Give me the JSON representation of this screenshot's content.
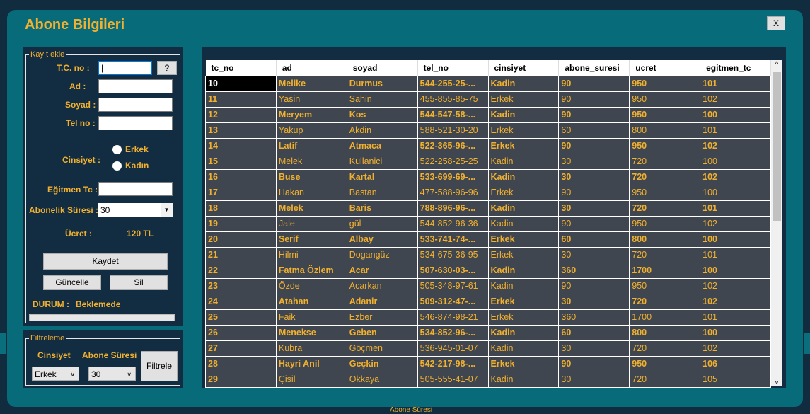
{
  "window": {
    "title": "Abone Bilgileri",
    "close_label": "X"
  },
  "background": {
    "legend": "Abone Süresi"
  },
  "kayit": {
    "legend": "Kayıt ekle",
    "tc_label": "T.C. no :",
    "help_label": "?",
    "ad_label": "Ad :",
    "soyad_label": "Soyad :",
    "tel_label": "Tel no :",
    "cinsiyet_label": "Cinsiyet :",
    "erkek": "Erkek",
    "kadin": "Kadın",
    "egitmen_label": "Eğitmen Tc :",
    "sure_label": "Abonelik Süresi :",
    "sure_value": "30",
    "ucret_label": "Ücret :",
    "ucret_value": "120 TL",
    "kaydet": "Kaydet",
    "guncelle": "Güncelle",
    "sil": "Sil",
    "durum_label": "DURUM :",
    "durum_value": "Beklemede",
    "progress": 0
  },
  "filtre": {
    "legend": "Filtreleme",
    "cinsiyet_label": "Cinsiyet",
    "sure_label": "Abone Süresi",
    "cinsiyet_value": "Erkek",
    "sure_value": "30",
    "button": "Filtrele"
  },
  "grid": {
    "columns": [
      "tc_no",
      "ad",
      "soyad",
      "tel_no",
      "cinsiyet",
      "abone_suresi",
      "ucret",
      "egitmen_tc"
    ],
    "rows": [
      [
        "10",
        "Melike",
        "Durmus",
        "544-255-25-...",
        "Kadin",
        "90",
        "950",
        "101"
      ],
      [
        "11",
        "Yasin",
        "Sahin",
        "455-855-85-75",
        "Erkek",
        "90",
        "950",
        "102"
      ],
      [
        "12",
        "Meryem",
        "Kos",
        "544-547-58-...",
        "Kadin",
        "90",
        "950",
        "100"
      ],
      [
        "13",
        "Yakup",
        "Akdin",
        "588-521-30-20",
        "Erkek",
        "60",
        "800",
        "101"
      ],
      [
        "14",
        "Latif",
        "Atmaca",
        "522-365-96-...",
        "Erkek",
        "90",
        "950",
        "102"
      ],
      [
        "15",
        "Melek",
        "Kullanici",
        "522-258-25-25",
        "Kadin",
        "30",
        "720",
        "100"
      ],
      [
        "16",
        "Buse",
        "Kartal",
        "533-699-69-...",
        "Kadin",
        "30",
        "720",
        "102"
      ],
      [
        "17",
        "Hakan",
        "Bastan",
        "477-588-96-96",
        "Erkek",
        "90",
        "950",
        "100"
      ],
      [
        "18",
        "Melek",
        "Baris",
        "788-896-96-...",
        "Kadin",
        "30",
        "720",
        "101"
      ],
      [
        "19",
        "Jale",
        "gül",
        "544-852-96-36",
        "Kadin",
        "90",
        "950",
        "102"
      ],
      [
        "20",
        "Serif",
        "Albay",
        "533-741-74-...",
        "Erkek",
        "60",
        "800",
        "100"
      ],
      [
        "21",
        "Hilmi",
        "Dogangüz",
        "534-675-36-95",
        "Erkek",
        "30",
        "720",
        "101"
      ],
      [
        "22",
        "Fatma Özlem",
        "Acar",
        "507-630-03-...",
        "Kadin",
        "360",
        "1700",
        "100"
      ],
      [
        "23",
        "Özde",
        "Acarkan",
        "505-348-97-61",
        "Kadin",
        "90",
        "950",
        "102"
      ],
      [
        "24",
        "Atahan",
        "Adanir",
        "509-312-47-...",
        "Erkek",
        "30",
        "720",
        "102"
      ],
      [
        "25",
        "Faik",
        "Ezber",
        "546-874-98-21",
        "Erkek",
        "360",
        "1700",
        "101"
      ],
      [
        "26",
        "Menekse",
        "Geben",
        "534-852-96-...",
        "Kadin",
        "60",
        "800",
        "100"
      ],
      [
        "27",
        "Kubra",
        "Göçmen",
        "536-945-01-07",
        "Kadin",
        "30",
        "720",
        "102"
      ],
      [
        "28",
        "Hayri Anil",
        "Geçkin",
        "542-217-98-...",
        "Erkek",
        "90",
        "950",
        "106"
      ],
      [
        "29",
        "Çisil",
        "Okkaya",
        "505-555-41-07",
        "Kadin",
        "30",
        "720",
        "105"
      ]
    ]
  }
}
